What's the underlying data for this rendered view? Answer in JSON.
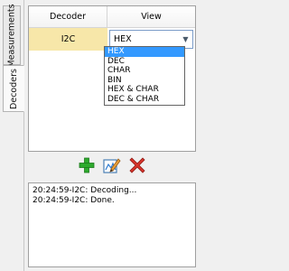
{
  "side_tabs": {
    "measurements": "Measurements",
    "decoders": "Decoders"
  },
  "table": {
    "headers": {
      "decoder": "Decoder",
      "view": "View"
    },
    "rows": [
      {
        "decoder": "I2C",
        "view": "HEX"
      }
    ]
  },
  "view_dropdown": {
    "selected": "HEX",
    "options": [
      "HEX",
      "DEC",
      "CHAR",
      "BIN",
      "HEX & CHAR",
      "DEC & CHAR"
    ]
  },
  "toolbar": {
    "add_icon": "plus-icon",
    "edit_icon": "edit-icon",
    "remove_icon": "delete-icon"
  },
  "log": {
    "lines": [
      "20:24:59-I2C: Decoding...",
      "20:24:59-I2C: Done."
    ]
  },
  "colors": {
    "selected_row": "#f7e7a9",
    "selection_highlight": "#3399ff",
    "add_green": "#2eaa2e",
    "delete_red": "#d9342b"
  }
}
